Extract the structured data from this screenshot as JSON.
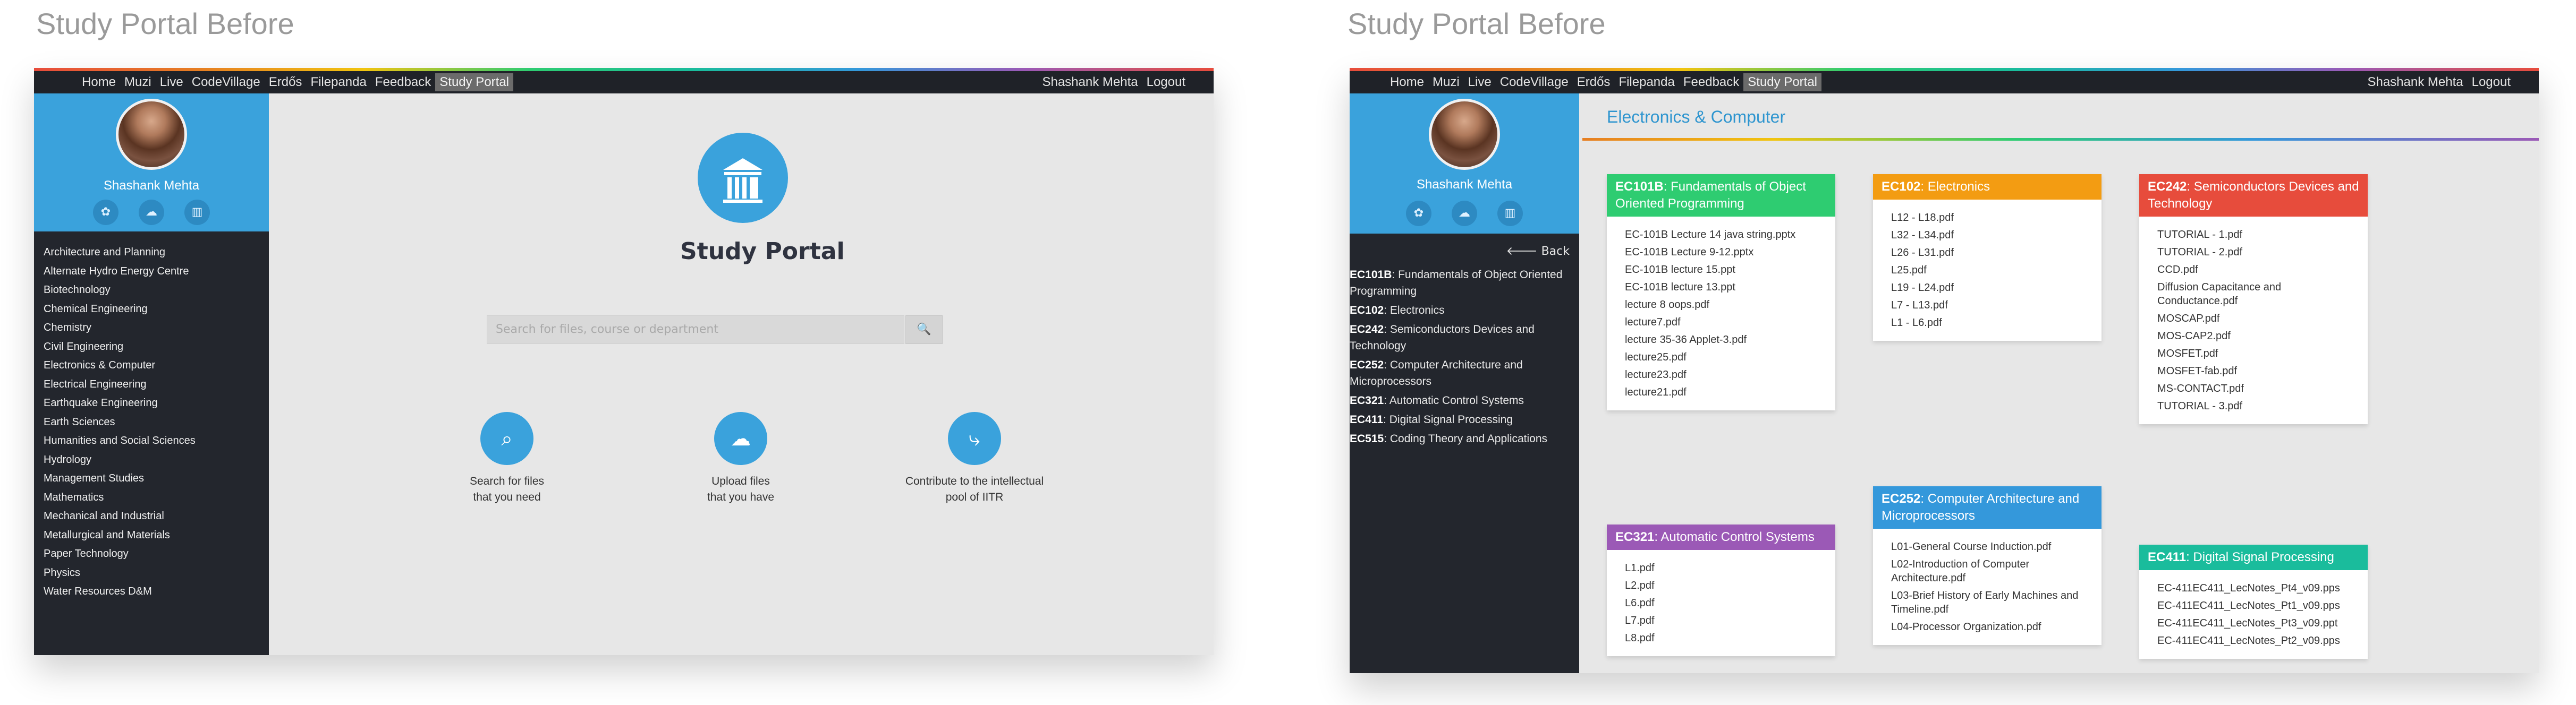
{
  "panels": [
    {
      "title": "Study Portal Before",
      "nav": {
        "left": [
          "Home",
          "Muzi",
          "Live",
          "CodeVillage",
          "Erdős",
          "Filepanda",
          "Feedback",
          "Study Portal"
        ],
        "right": [
          "Shashank Mehta",
          "Logout"
        ],
        "active_index": 7
      },
      "profile": {
        "name": "Shashank Mehta",
        "icons": [
          "settings-icon",
          "cloud-icon",
          "building-icon"
        ]
      },
      "departments": [
        "Architecture and Planning",
        "Alternate Hydro Energy Centre",
        "Biotechnology",
        "Chemical Engineering",
        "Chemistry",
        "Civil Engineering",
        "Electronics & Computer",
        "Electrical Engineering",
        "Earthquake Engineering",
        "Earth Sciences",
        "Humanities and Social Sciences",
        "Hydrology",
        "Management Studies",
        "Mathematics",
        "Mechanical and Industrial",
        "Metallurgical and Materials",
        "Paper Technology",
        "Physics",
        "Water Resources D&M"
      ],
      "main": {
        "title": "Study Portal",
        "search_placeholder": "Search for files, course or department",
        "features": [
          {
            "line1": "Search for files",
            "line2": "that you need",
            "icon": "search-icon"
          },
          {
            "line1": "Upload files",
            "line2": "that you have",
            "icon": "upload-cloud-icon"
          },
          {
            "line1": "Contribute to the intellectual",
            "line2": "pool of IITR",
            "icon": "share-icon"
          }
        ]
      }
    },
    {
      "title": "Study Portal Before",
      "nav": {
        "left": [
          "Home",
          "Muzi",
          "Live",
          "CodeVillage",
          "Erdős",
          "Filepanda",
          "Feedback",
          "Study Portal"
        ],
        "right": [
          "Shashank Mehta",
          "Logout"
        ],
        "active_index": 7
      },
      "profile": {
        "name": "Shashank Mehta",
        "icons": [
          "settings-icon",
          "cloud-icon",
          "building-icon"
        ]
      },
      "back_label": "Back",
      "courses": [
        {
          "code": "EC101B",
          "name": "Fundamentals of Object Oriented Programming"
        },
        {
          "code": "EC102",
          "name": "Electronics"
        },
        {
          "code": "EC242",
          "name": "Semiconductors Devices and Technology"
        },
        {
          "code": "EC252",
          "name": "Computer Architecture and Microprocessors"
        },
        {
          "code": "EC321",
          "name": "Automatic Control Systems"
        },
        {
          "code": "EC411",
          "name": "Digital Signal Processing"
        },
        {
          "code": "EC515",
          "name": "Coding Theory and Applications"
        }
      ],
      "department_heading": "Electronics & Computer",
      "cards": [
        {
          "code": "EC101B",
          "name": "Fundamentals of Object Oriented Programming",
          "color": "#2ecc71",
          "files": [
            "EC-101B Lecture 14 java string.pptx",
            "EC-101B Lecture 9-12.pptx",
            "EC-101B lecture 15.ppt",
            "EC-101B lecture 13.ppt",
            "lecture 8 oops.pdf",
            "lecture7.pdf",
            "lecture 35-36 Applet-3.pdf",
            "lecture25.pdf",
            "lecture23.pdf",
            "lecture21.pdf"
          ]
        },
        {
          "code": "EC102",
          "name": "Electronics",
          "color": "#f39c12",
          "files": [
            "L12 - L18.pdf",
            "L32 - L34.pdf",
            "L26 - L31.pdf",
            "L25.pdf",
            "L19 - L24.pdf",
            "L7 - L13.pdf",
            "L1 - L6.pdf"
          ]
        },
        {
          "code": "EC242",
          "name": "Semiconductors Devices and Technology",
          "color": "#e74c3c",
          "files": [
            "TUTORIAL - 1.pdf",
            "TUTORIAL - 2.pdf",
            "CCD.pdf",
            "Diffusion Capacitance and Conductance.pdf",
            "MOSCAP.pdf",
            "MOS-CAP2.pdf",
            "MOSFET.pdf",
            "MOSFET-fab.pdf",
            "MS-CONTACT.pdf",
            "TUTORIAL - 3.pdf"
          ]
        },
        {
          "code": "EC252",
          "name": "Computer Architecture and Microprocessors",
          "color": "#3498db",
          "files": [
            "L01-General Course Induction.pdf",
            "L02-Introduction of Computer Architecture.pdf",
            "L03-Brief History of Early Machines and Timeline.pdf",
            "L04-Processor Organization.pdf"
          ]
        },
        {
          "code": "EC321",
          "name": "Automatic Control Systems",
          "color": "#9b59b6",
          "files": [
            "L1.pdf",
            "L2.pdf",
            "L6.pdf",
            "L7.pdf",
            "L8.pdf"
          ]
        },
        {
          "code": "EC411",
          "name": "Digital Signal Processing",
          "color": "#1abc9c",
          "files": [
            "EC-411EC411_LecNotes_Pt4_v09.pps",
            "EC-411EC411_LecNotes_Pt1_v09.pps",
            "EC-411EC411_LecNotes_Pt3_v09.ppt",
            "EC-411EC411_LecNotes_Pt2_v09.pps"
          ]
        }
      ]
    }
  ]
}
